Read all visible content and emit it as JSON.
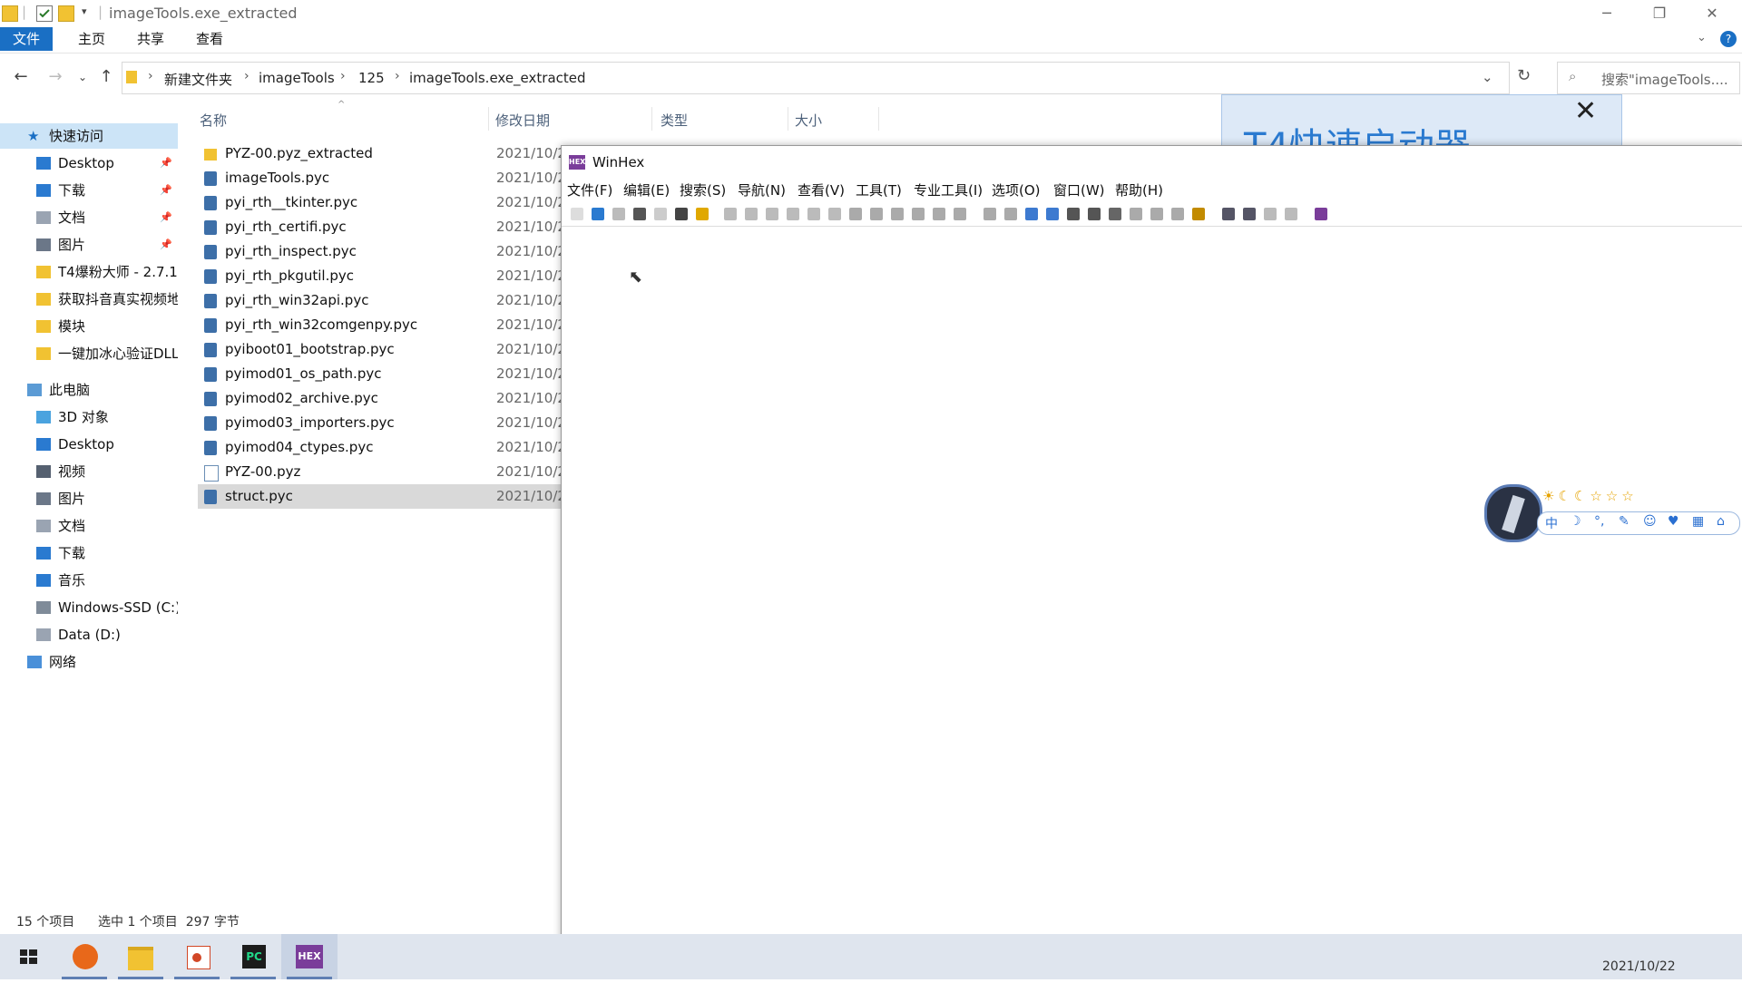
{
  "window": {
    "title": "imageTools.exe_extracted"
  },
  "ribbon": {
    "tabs": [
      "文件",
      "主页",
      "共享",
      "查看"
    ]
  },
  "address": {
    "crumbs": [
      "新建文件夹",
      "imageTools",
      "125",
      "imageTools.exe_extracted"
    ],
    "search_placeholder": "搜索\"imageTools...."
  },
  "nav": {
    "quick_access": "快速访问",
    "quick_items": [
      {
        "label": "Desktop",
        "icon": "desktop-icon",
        "pinned": true
      },
      {
        "label": "下载",
        "icon": "download-icon",
        "pinned": true
      },
      {
        "label": "文档",
        "icon": "document-icon",
        "pinned": true
      },
      {
        "label": "图片",
        "icon": "picture-icon",
        "pinned": true
      },
      {
        "label": "T4爆粉大师 - 2.7.1.",
        "icon": "folder-icon",
        "pinned": false
      },
      {
        "label": "获取抖音真实视频地",
        "icon": "folder-icon",
        "pinned": false
      },
      {
        "label": "模块",
        "icon": "folder-icon",
        "pinned": false
      },
      {
        "label": "一键加冰心验证DLL",
        "icon": "folder-icon",
        "pinned": false
      }
    ],
    "this_pc": "此电脑",
    "pc_items": [
      {
        "label": "3D 对象",
        "icon": "cube-icon"
      },
      {
        "label": "Desktop",
        "icon": "desktop-icon"
      },
      {
        "label": "视频",
        "icon": "video-icon"
      },
      {
        "label": "图片",
        "icon": "picture-icon"
      },
      {
        "label": "文档",
        "icon": "document-icon"
      },
      {
        "label": "下载",
        "icon": "download-icon"
      },
      {
        "label": "音乐",
        "icon": "music-icon"
      },
      {
        "label": "Windows-SSD (C:)",
        "icon": "drive-c-icon"
      },
      {
        "label": "Data (D:)",
        "icon": "drive-icon"
      }
    ],
    "network": "网络"
  },
  "columns": {
    "name": "名称",
    "modified": "修改日期",
    "type": "类型",
    "size": "大小"
  },
  "files": [
    {
      "name": "PYZ-00.pyz_extracted",
      "date": "2021/10/2",
      "kind": "folder"
    },
    {
      "name": "imageTools.pyc",
      "date": "2021/10/2",
      "kind": "pyc"
    },
    {
      "name": "pyi_rth__tkinter.pyc",
      "date": "2021/10/2",
      "kind": "pyc"
    },
    {
      "name": "pyi_rth_certifi.pyc",
      "date": "2021/10/2",
      "kind": "pyc"
    },
    {
      "name": "pyi_rth_inspect.pyc",
      "date": "2021/10/2",
      "kind": "pyc"
    },
    {
      "name": "pyi_rth_pkgutil.pyc",
      "date": "2021/10/2",
      "kind": "pyc"
    },
    {
      "name": "pyi_rth_win32api.pyc",
      "date": "2021/10/2",
      "kind": "pyc"
    },
    {
      "name": "pyi_rth_win32comgenpy.pyc",
      "date": "2021/10/2",
      "kind": "pyc"
    },
    {
      "name": "pyiboot01_bootstrap.pyc",
      "date": "2021/10/2",
      "kind": "pyc"
    },
    {
      "name": "pyimod01_os_path.pyc",
      "date": "2021/10/2",
      "kind": "pyc"
    },
    {
      "name": "pyimod02_archive.pyc",
      "date": "2021/10/2",
      "kind": "pyc"
    },
    {
      "name": "pyimod03_importers.pyc",
      "date": "2021/10/2",
      "kind": "pyc"
    },
    {
      "name": "pyimod04_ctypes.pyc",
      "date": "2021/10/2",
      "kind": "pyc"
    },
    {
      "name": "PYZ-00.pyz",
      "date": "2021/10/2",
      "kind": "pyz"
    },
    {
      "name": "struct.pyc",
      "date": "2021/10/2",
      "kind": "pyc",
      "selected": true
    }
  ],
  "status": {
    "count": "15 个项目",
    "selection": "选中 1 个项目  297 字节"
  },
  "banner": {
    "text": "T4快速启动器"
  },
  "winhex": {
    "title": "WinHex",
    "menu": [
      "文件(F)",
      "编辑(E)",
      "搜索(S)",
      "导航(N)",
      "查看(V)",
      "工具(T)",
      "专业工具(I)",
      "选项(O)",
      "窗口(W)",
      "帮助(H)"
    ]
  },
  "widget": {
    "status_icons": "☀☾☾☆☆☆",
    "tools": [
      "中",
      "☽",
      "°,",
      "✎",
      "☺",
      "♥",
      "▦",
      "⌂"
    ]
  },
  "taskbar": {
    "date": "2021/10/22"
  },
  "colors": {
    "accent": "#1a6fc4",
    "selected_row": "#d9d9d9",
    "nav_selected": "#cce4f7",
    "taskbar": "#dfe5ee"
  }
}
